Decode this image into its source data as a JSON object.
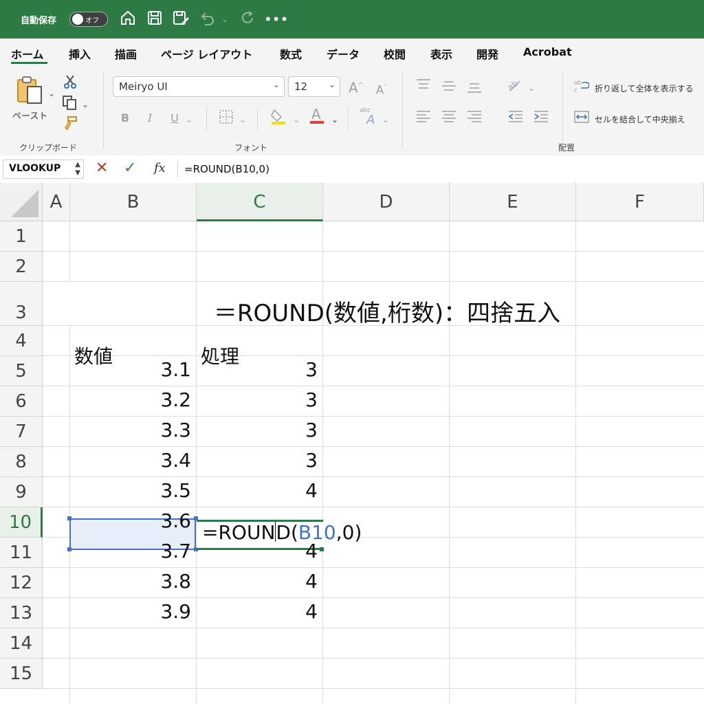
{
  "titlebar": {
    "autosave_label": "自動保存",
    "toggle_label": "オフ"
  },
  "tabs": [
    "ホーム",
    "挿入",
    "描画",
    "ページ レイアウト",
    "数式",
    "データ",
    "校閲",
    "表示",
    "開発",
    "Acrobat"
  ],
  "ribbon": {
    "paste_label": "ペースト",
    "clipboard_group": "クリップボード",
    "font_group": "フォント",
    "alignment_group": "配置",
    "font_name": "Meiryo UI",
    "font_size": "12",
    "bold": "B",
    "italic": "I",
    "underline": "U",
    "wrap_text": "折り返して全体を表示する",
    "merge_center": "セルを結合して中央揃え"
  },
  "formula_bar": {
    "name_box": "VLOOKUP",
    "fx": "fx",
    "formula": "=ROUND(B10,0)"
  },
  "sheet": {
    "columns": [
      "A",
      "B",
      "C",
      "D",
      "E",
      "F"
    ],
    "rows": [
      "1",
      "2",
      "3",
      "4",
      "5",
      "6",
      "7",
      "8",
      "9",
      "10",
      "11",
      "12",
      "13",
      "14",
      "15"
    ],
    "title": "＝ROUND(数値,桁数)：四捨五入",
    "header_b": "数値",
    "header_c": "処理",
    "values_b": [
      "3.1",
      "3.2",
      "3.3",
      "3.4",
      "3.5",
      "3.6",
      "3.7",
      "3.8",
      "3.9"
    ],
    "values_c": [
      "3",
      "3",
      "3",
      "3",
      "4",
      "",
      "4",
      "4",
      "4"
    ],
    "editing": {
      "prefix": "=ROUN",
      "suffix_start": "D(",
      "ref": "B10",
      "suffix": ",0)"
    }
  }
}
